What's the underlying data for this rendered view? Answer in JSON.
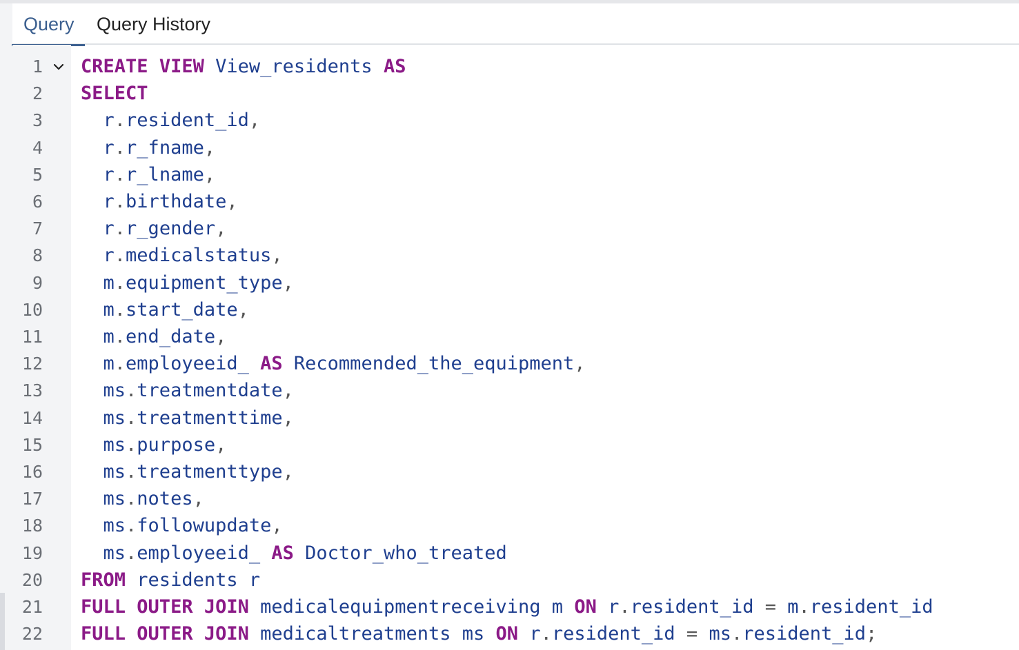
{
  "tabs": [
    {
      "label": "Query",
      "active": true
    },
    {
      "label": "Query History",
      "active": false
    }
  ],
  "lines": [
    "CREATE VIEW View_residents AS",
    "SELECT",
    "  r.resident_id,",
    "  r.r_fname,",
    "  r.r_lname,",
    "  r.birthdate,",
    "  r.r_gender,",
    "  r.medicalstatus,",
    "  m.equipment_type,",
    "  m.start_date,",
    "  m.end_date,",
    "  m.employeeid_ AS Recommended_the_equipment,",
    "  ms.treatmentdate,",
    "  ms.treatmenttime,",
    "  ms.purpose,",
    "  ms.treatmenttype,",
    "  ms.notes,",
    "  ms.followupdate,",
    "  ms.employeeid_ AS Doctor_who_treated",
    "FROM residents r",
    "FULL OUTER JOIN medicalequipmentreceiving m ON r.resident_id = m.resident_id",
    "FULL OUTER JOIN medicaltreatments ms ON r.resident_id = ms.resident_id;"
  ],
  "keywords": [
    "CREATE",
    "VIEW",
    "AS",
    "SELECT",
    "FROM",
    "FULL",
    "OUTER",
    "JOIN",
    "ON"
  ],
  "colors": {
    "keyword": "#8b1a87",
    "identifier": "#1f3f8f",
    "active_tab": "#3b5f8f"
  },
  "icons": {
    "fold": "chevron-down-icon"
  }
}
